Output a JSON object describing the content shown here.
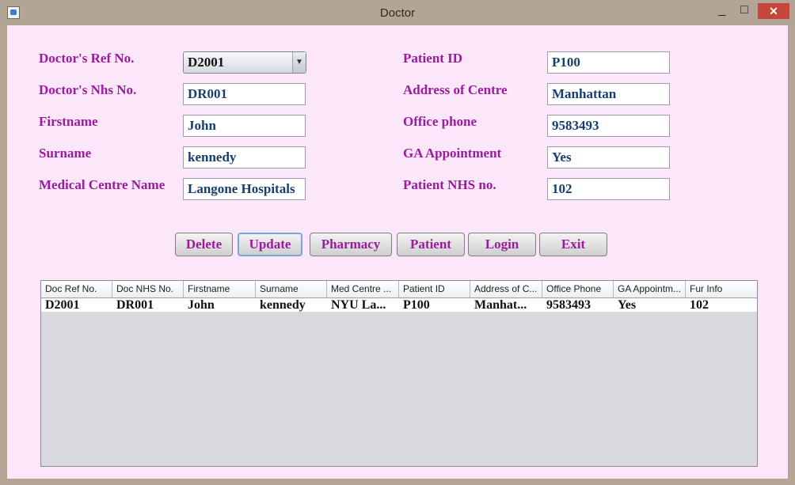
{
  "window": {
    "title": "Doctor",
    "controls": {
      "minimize": "_",
      "maximize": "□",
      "close": "✕"
    }
  },
  "form": {
    "left": [
      {
        "label": "Doctor's Ref No.",
        "value": "D2001",
        "control": "combobox"
      },
      {
        "label": "Doctor's Nhs No.",
        "value": "DR001"
      },
      {
        "label": "Firstname",
        "value": "John"
      },
      {
        "label": "Surname",
        "value": "kennedy"
      },
      {
        "label": "Medical Centre Name",
        "value": "Langone Hospitals"
      }
    ],
    "right": [
      {
        "label": "Patient ID",
        "value": "P100"
      },
      {
        "label": "Address of Centre",
        "value": "Manhattan"
      },
      {
        "label": "Office phone",
        "value": "9583493"
      },
      {
        "label": "GA Appointment",
        "value": "Yes"
      },
      {
        "label": "Patient NHS no.",
        "value": "102"
      }
    ]
  },
  "buttons": {
    "delete": "Delete",
    "update": "Update",
    "pharmacy": "Pharmacy",
    "patient": "Patient",
    "login": "Login",
    "exit": "Exit"
  },
  "table": {
    "columns": [
      "Doc Ref No.",
      "Doc NHS No.",
      "Firstname",
      "Surname",
      "Med Centre ...",
      "Patient ID",
      "Address of C...",
      "Office Phone",
      "GA Appointm...",
      "Fur Info"
    ],
    "rows": [
      [
        "D2001",
        "DR001",
        "John",
        "kennedy",
        "NYU La...",
        "P100",
        "Manhat...",
        "9583493",
        "Yes",
        "102"
      ]
    ]
  },
  "colors": {
    "label": "#9b1aa0",
    "field_text": "#163f6e",
    "content_bg": "#fbe6fa",
    "titlebar": "#b3a595",
    "close_button": "#c7463c"
  }
}
